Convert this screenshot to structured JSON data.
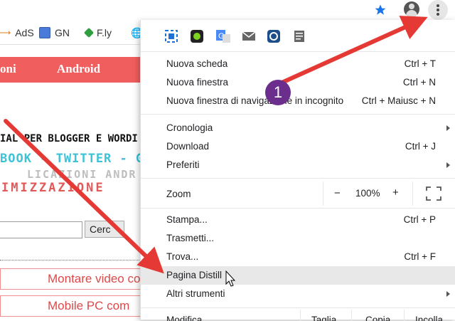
{
  "bookmarks": [
    {
      "label": "AdS",
      "icon": "ads-icon"
    },
    {
      "label": "GN",
      "icon": "gn-icon"
    },
    {
      "label": "F.ly",
      "icon": "fly-icon"
    }
  ],
  "page": {
    "nav": [
      "oni",
      "Android"
    ],
    "banner_lines": [
      "IAL PER BLOGGER E WORDI",
      "BOOK - TWITTER - GOO",
      "LICAZIONI ANDR",
      "IMIZZAZIONE"
    ],
    "search_button": "Cerc",
    "links": [
      "Montare video co",
      "Mobile PC com"
    ]
  },
  "menu": {
    "extensions": [
      "screenshot-ext-icon",
      "green-circle-ext-icon",
      "translate-ext-icon",
      "mail-ext-icon",
      "blue-circle-ext-icon",
      "doc-ext-icon"
    ],
    "new_tab": {
      "label": "Nuova scheda",
      "shortcut": "Ctrl + T"
    },
    "new_window": {
      "label": "Nuova finestra",
      "shortcut": "Ctrl + N"
    },
    "incognito": {
      "label": "Nuova finestra di navigazione in incognito",
      "shortcut": "Ctrl + Maiusc + N"
    },
    "history": {
      "label": "Cronologia"
    },
    "downloads": {
      "label": "Download",
      "shortcut": "Ctrl + J"
    },
    "bookmarks": {
      "label": "Preferiti"
    },
    "zoom": {
      "label": "Zoom",
      "minus": "−",
      "value": "100%",
      "plus": "+"
    },
    "print": {
      "label": "Stampa...",
      "shortcut": "Ctrl + P"
    },
    "cast": {
      "label": "Trasmetti..."
    },
    "find": {
      "label": "Trova...",
      "shortcut": "Ctrl + F"
    },
    "distill": {
      "label": "Pagina Distill"
    },
    "more_tools": {
      "label": "Altri strumenti"
    },
    "edit_row": {
      "label": "Modifica",
      "cut": "Taglia",
      "copy": "Copia",
      "paste": "Incolla"
    }
  },
  "annotation": {
    "badge": "1"
  },
  "colors": {
    "accent_red": "#e53935",
    "nav_red": "#f15e5e",
    "badge_purple": "#6b2e8c",
    "star_blue": "#1a73e8"
  }
}
